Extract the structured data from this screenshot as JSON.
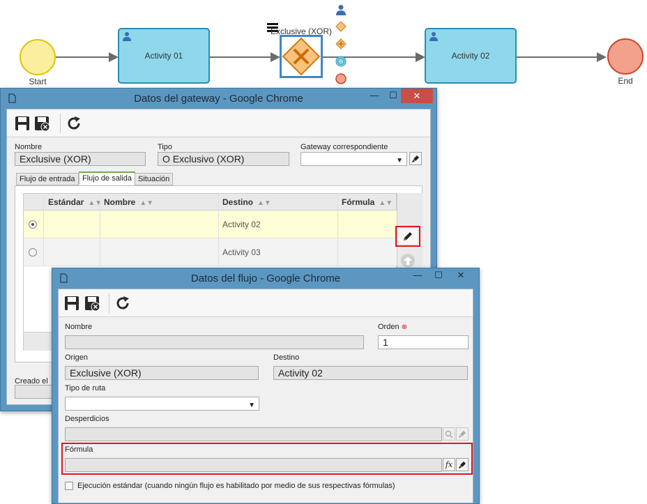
{
  "diagram": {
    "start_label": "Start",
    "end_label": "End",
    "activity1": "Activity 01",
    "activity2": "Activity 02",
    "gateway_label": "Exclusive (XOR)",
    "palette_icons": [
      "user-icon",
      "gateway-diamond-icon",
      "plus-diamond-icon",
      "intermediate-event-icon",
      "end-event-icon"
    ]
  },
  "gateway_window": {
    "title": "Datos del gateway - Google Chrome",
    "toolbar": [
      "save-icon",
      "save-close-icon",
      "refresh-icon"
    ],
    "nombre_label": "Nombre",
    "nombre_value": "Exclusive (XOR)",
    "tipo_label": "Tipo",
    "tipo_value": "O Exclusivo (XOR)",
    "gateway_corr_label": "Gateway correspondiente",
    "gateway_corr_value": "",
    "tabs": [
      "Flujo de entrada",
      "Flujo de salida",
      "Situación"
    ],
    "active_tab": "Flujo de salida",
    "columns": [
      "Estándar",
      "Nombre",
      "Destino",
      "Fórmula"
    ],
    "rows": [
      {
        "estandar": "",
        "nombre": "",
        "destino": "Activity 02",
        "formula": "",
        "selected": true
      },
      {
        "estandar": "",
        "nombre": "",
        "destino": "Activity 03",
        "formula": "",
        "selected": false
      }
    ],
    "creado_label": "Creado el"
  },
  "flow_window": {
    "title": "Datos del flujo - Google Chrome",
    "toolbar": [
      "save-icon",
      "save-close-icon",
      "refresh-icon"
    ],
    "nombre_label": "Nombre",
    "nombre_value": "",
    "orden_label": "Orden",
    "orden_value": "1",
    "origen_label": "Origen",
    "origen_value": "Exclusive (XOR)",
    "destino_label": "Destino",
    "destino_value": "Activity 02",
    "tipo_ruta_label": "Tipo de ruta",
    "tipo_ruta_value": "",
    "desperdicios_label": "Desperdicios",
    "desperdicios_value": "",
    "formula_label": "Fórmula",
    "formula_value": "",
    "checkbox_label": "Ejecución estándar (cuando ningún flujo es habilitado por medio de sus respectivas fórmulas)",
    "checkbox_checked": false
  },
  "colors": {
    "window_frame": "#5b97c1",
    "close_button": "#c74f47",
    "highlight": "#e0161b",
    "task_fill": "#8fd8ec",
    "gateway_fill": "#f9c27e"
  }
}
